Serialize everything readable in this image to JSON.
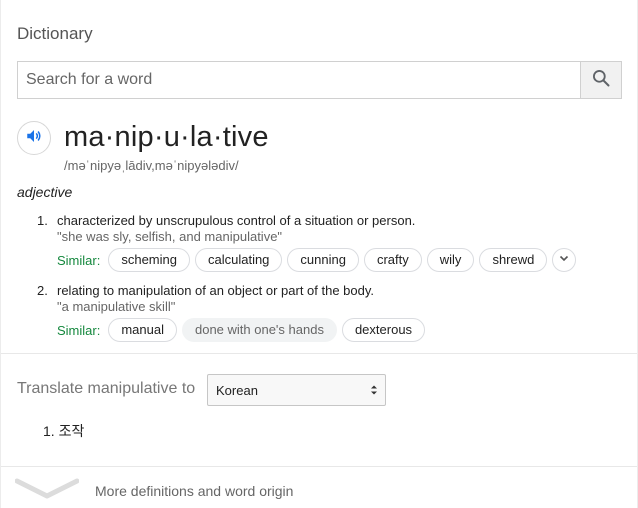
{
  "header": {
    "title": "Dictionary"
  },
  "search": {
    "placeholder": "Search for a word",
    "value": ""
  },
  "entry": {
    "word": "ma·nip·u·la·tive",
    "phonetic": "/məˈnipyəˌlādiv,məˈnipyələdiv/",
    "part_of_speech": "adjective",
    "senses": [
      {
        "number": "1.",
        "definition": "characterized by unscrupulous control of a situation or person.",
        "example": "\"she was sly, selfish, and manipulative\"",
        "similar_label": "Similar:",
        "similar": [
          "scheming",
          "calculating",
          "cunning",
          "crafty",
          "wily",
          "shrewd"
        ]
      },
      {
        "number": "2.",
        "definition": "relating to manipulation of an object or part of the body.",
        "example": "\"a manipulative skill\"",
        "similar_label": "Similar:",
        "similar": [
          "manual",
          "done with one's hands",
          "dexterous"
        ]
      }
    ]
  },
  "translate": {
    "label": "Translate manipulative to",
    "language": "Korean",
    "results": [
      {
        "number": "1.",
        "text": "조작"
      }
    ]
  },
  "footer": {
    "more_label": "More definitions and word origin"
  },
  "colors": {
    "similar_label": "#15883e",
    "speaker_icon": "#1a73e8",
    "search_icon": "#5f6368"
  },
  "icons": {
    "search": "search-icon",
    "speaker": "speaker-icon",
    "expand": "chevron-down-icon",
    "select_arrows": "up-down-arrows-icon",
    "more": "chevron-down-icon"
  }
}
